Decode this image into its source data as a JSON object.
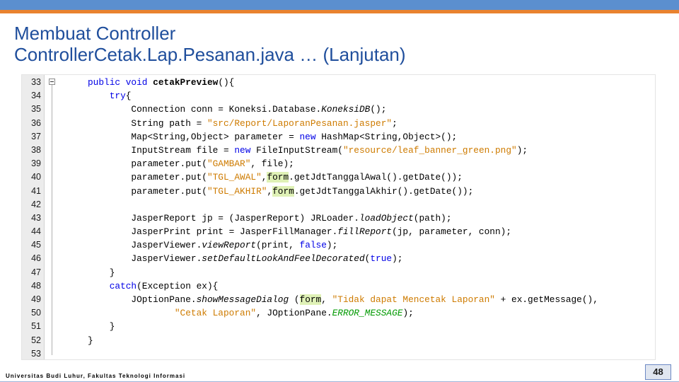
{
  "slide": {
    "title_line1": "Membuat Controller",
    "title_line2": "ControllerCetak.Lap.Pesanan.java … (Lanjutan)",
    "footer": "Universitas Budi Luhur, Fakultas Teknologi Informasi",
    "page_number": "48"
  },
  "colors": {
    "title": "#1f4e9c",
    "top_bar": "#5b8fcf",
    "accent_orange": "#e9822f",
    "keyword": "#0000e6",
    "string": "#ce7b00",
    "constant": "#009900",
    "highlight": "#dff1b6"
  },
  "code": {
    "line_numbers": [
      "33",
      "34",
      "35",
      "36",
      "37",
      "38",
      "39",
      "40",
      "41",
      "42",
      "43",
      "44",
      "45",
      "46",
      "47",
      "48",
      "49",
      "50",
      "51",
      "52",
      "53"
    ],
    "lines": [
      {
        "segs": [
          [
            "kw",
            "public void "
          ],
          [
            "bold",
            "cetakPreview"
          ],
          [
            "",
            "(){"
          ]
        ]
      },
      {
        "segs": [
          [
            "",
            "    "
          ],
          [
            "kw",
            "try"
          ],
          [
            "",
            "{"
          ]
        ]
      },
      {
        "segs": [
          [
            "",
            "        Connection conn = Koneksi.Database."
          ],
          [
            "ital",
            "KoneksiDB"
          ],
          [
            "",
            "();"
          ]
        ]
      },
      {
        "segs": [
          [
            "",
            "        String path = "
          ],
          [
            "str",
            "\"src/Report/LaporanPesanan.jasper\""
          ],
          [
            "",
            ";"
          ]
        ]
      },
      {
        "segs": [
          [
            "",
            "        Map<String,Object> parameter = "
          ],
          [
            "kw",
            "new"
          ],
          [
            "",
            " HashMap<String,Object>();"
          ]
        ]
      },
      {
        "segs": [
          [
            "",
            "        InputStream file = "
          ],
          [
            "kw",
            "new"
          ],
          [
            "",
            " FileInputStream("
          ],
          [
            "str",
            "\"resource/leaf_banner_green.png\""
          ],
          [
            "",
            ");"
          ]
        ]
      },
      {
        "segs": [
          [
            "",
            "        parameter.put("
          ],
          [
            "str",
            "\"GAMBAR\""
          ],
          [
            "",
            ", file);"
          ]
        ]
      },
      {
        "segs": [
          [
            "",
            "        parameter.put("
          ],
          [
            "str",
            "\"TGL_AWAL\""
          ],
          [
            "",
            ","
          ],
          [
            "hl",
            "form"
          ],
          [
            "",
            ".getJdtTanggalAwal().getDate());"
          ]
        ]
      },
      {
        "segs": [
          [
            "",
            "        parameter.put("
          ],
          [
            "str",
            "\"TGL_AKHIR\""
          ],
          [
            "",
            ","
          ],
          [
            "hl",
            "form"
          ],
          [
            "",
            ".getJdtTanggalAkhir().getDate());"
          ]
        ]
      },
      {
        "segs": [
          [
            "",
            ""
          ]
        ]
      },
      {
        "segs": [
          [
            "",
            "        JasperReport jp = (JasperReport) JRLoader."
          ],
          [
            "ital",
            "loadObject"
          ],
          [
            "",
            "(path);"
          ]
        ]
      },
      {
        "segs": [
          [
            "",
            "        JasperPrint print = JasperFillManager."
          ],
          [
            "ital",
            "fillReport"
          ],
          [
            "",
            "(jp, parameter, conn);"
          ]
        ]
      },
      {
        "segs": [
          [
            "",
            "        JasperViewer."
          ],
          [
            "ital",
            "viewReport"
          ],
          [
            "",
            "(print, "
          ],
          [
            "kw",
            "false"
          ],
          [
            "",
            ");"
          ]
        ]
      },
      {
        "segs": [
          [
            "",
            "        JasperViewer."
          ],
          [
            "ital",
            "setDefaultLookAndFeelDecorated"
          ],
          [
            "",
            "("
          ],
          [
            "kw",
            "true"
          ],
          [
            "",
            ");"
          ]
        ]
      },
      {
        "segs": [
          [
            "",
            "    }"
          ]
        ]
      },
      {
        "segs": [
          [
            "",
            "    "
          ],
          [
            "kw",
            "catch"
          ],
          [
            "",
            "(Exception ex){"
          ]
        ]
      },
      {
        "segs": [
          [
            "",
            "        JOptionPane."
          ],
          [
            "ital",
            "showMessageDialog"
          ],
          [
            "",
            " ("
          ],
          [
            "hl",
            "form"
          ],
          [
            "",
            ", "
          ],
          [
            "str",
            "\"Tidak dapat Mencetak Laporan\""
          ],
          [
            "",
            " + ex.getMessage(),"
          ]
        ]
      },
      {
        "segs": [
          [
            "",
            "                "
          ],
          [
            "str",
            "\"Cetak Laporan\""
          ],
          [
            "",
            ", JOptionPane."
          ],
          [
            "const",
            "ERROR_MESSAGE"
          ],
          [
            "",
            ");"
          ]
        ]
      },
      {
        "segs": [
          [
            "",
            "    }"
          ]
        ]
      },
      {
        "segs": [
          [
            "",
            "}"
          ]
        ]
      },
      {
        "segs": [
          [
            "",
            ""
          ]
        ]
      }
    ]
  }
}
